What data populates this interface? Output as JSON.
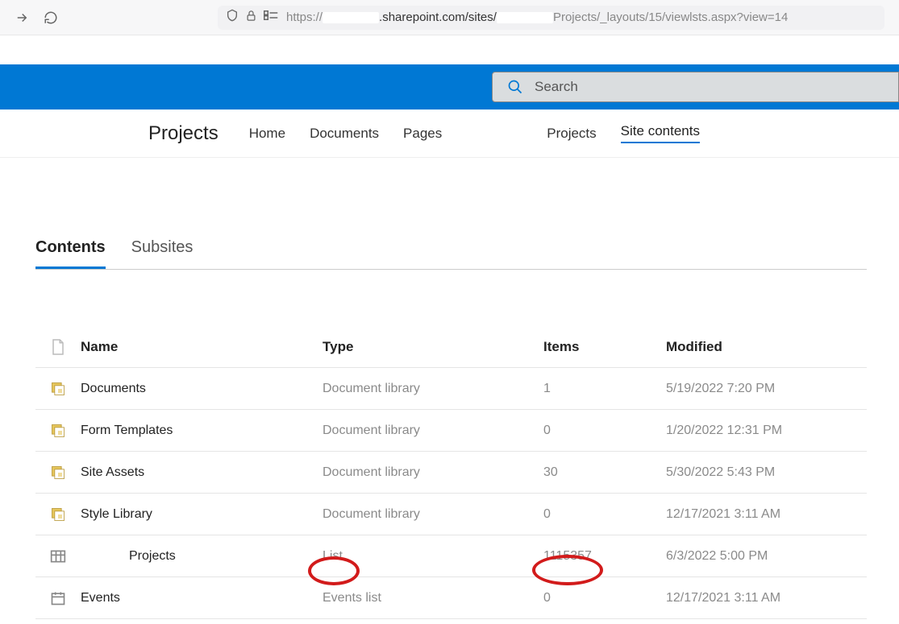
{
  "browser": {
    "url_prefix": "https://",
    "url_mid": ".sharepoint.com/sites/",
    "url_suffix": "Projects/_layouts/15/viewlsts.aspx?view=14"
  },
  "search": {
    "placeholder": "Search"
  },
  "site": {
    "title": "Projects",
    "nav": {
      "home": "Home",
      "documents": "Documents",
      "pages": "Pages",
      "projects": "Projects",
      "site_contents": "Site contents"
    }
  },
  "tabs": {
    "contents": "Contents",
    "subsites": "Subsites"
  },
  "table": {
    "headers": {
      "name": "Name",
      "type": "Type",
      "items": "Items",
      "modified": "Modified"
    },
    "rows": [
      {
        "icon": "library",
        "name": "Documents",
        "type": "Document library",
        "items": "1",
        "modified": "5/19/2022 7:20 PM",
        "indent": false
      },
      {
        "icon": "library",
        "name": "Form Templates",
        "type": "Document library",
        "items": "0",
        "modified": "1/20/2022 12:31 PM",
        "indent": false
      },
      {
        "icon": "library",
        "name": "Site Assets",
        "type": "Document library",
        "items": "30",
        "modified": "5/30/2022 5:43 PM",
        "indent": false
      },
      {
        "icon": "library",
        "name": "Style Library",
        "type": "Document library",
        "items": "0",
        "modified": "12/17/2021 3:11 AM",
        "indent": false
      },
      {
        "icon": "list",
        "name": "Projects",
        "type": "List",
        "items": "1115357",
        "modified": "6/3/2022 5:00 PM",
        "indent": true
      },
      {
        "icon": "events",
        "name": "Events",
        "type": "Events list",
        "items": "0",
        "modified": "12/17/2021 3:11 AM",
        "indent": false
      }
    ]
  }
}
